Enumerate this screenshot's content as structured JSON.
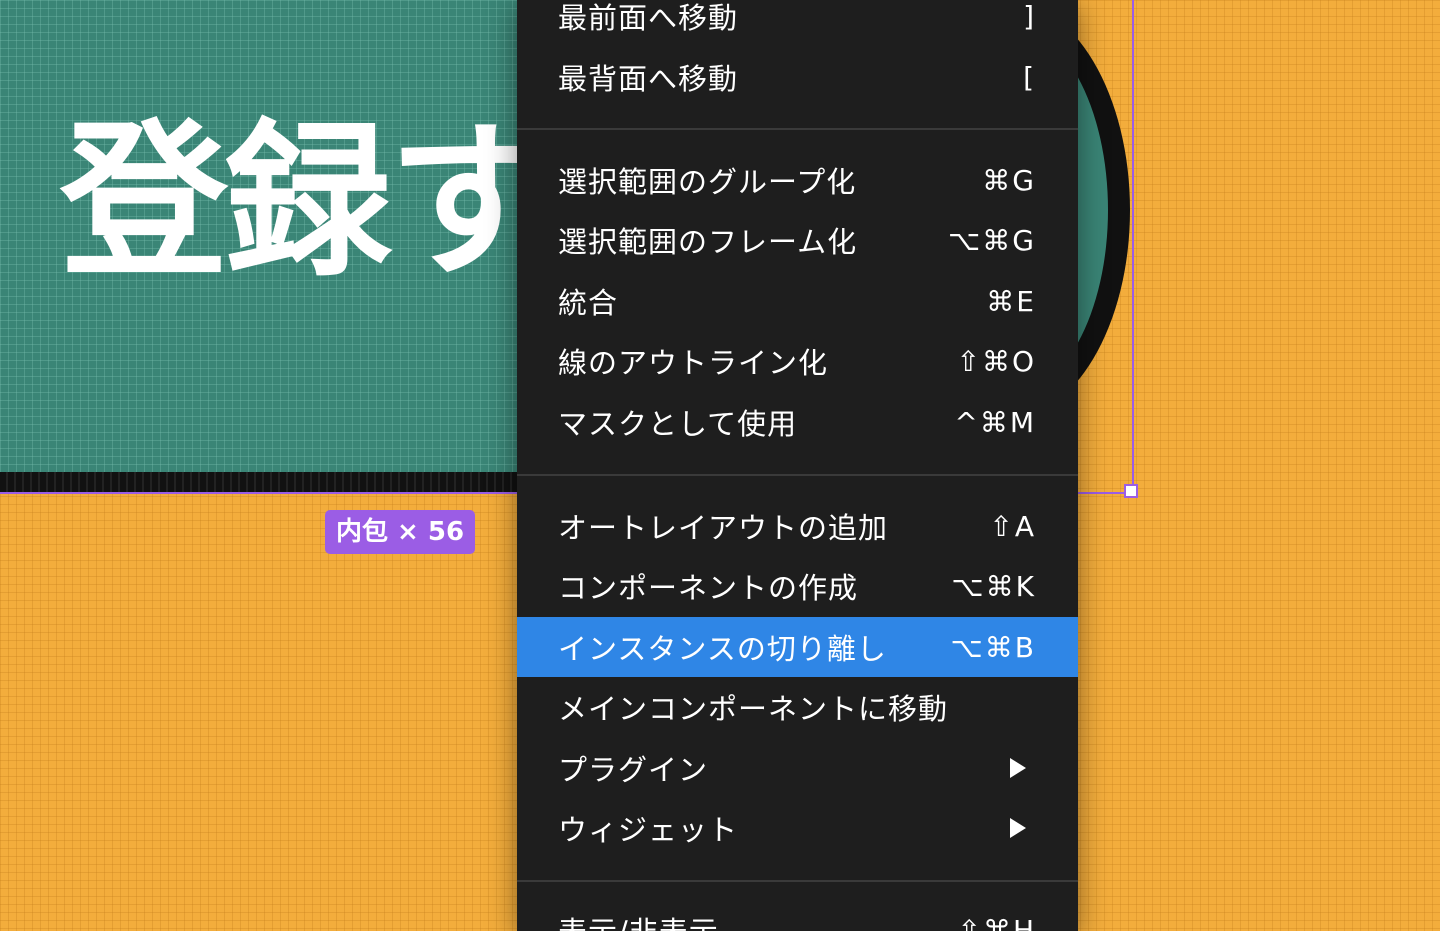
{
  "canvas": {
    "frame_text": "登録す",
    "hug_badge": "内包 × 56"
  },
  "colors": {
    "canvas_bg": "#f3ad3c",
    "frame_bg": "#3a8576",
    "selection": "#9b5de5",
    "menu_bg": "#1e1e1e",
    "menu_highlight": "#2f86e6"
  },
  "menu": {
    "items": [
      {
        "label": "最前面へ移動",
        "shortcut": "]"
      },
      {
        "label": "最背面へ移動",
        "shortcut": "["
      },
      {
        "label": "選択範囲のグループ化",
        "shortcut": "⌘G"
      },
      {
        "label": "選択範囲のフレーム化",
        "shortcut": "⌥⌘G"
      },
      {
        "label": "統合",
        "shortcut": "⌘E"
      },
      {
        "label": "線のアウトライン化",
        "shortcut": "⇧⌘O"
      },
      {
        "label": "マスクとして使用",
        "shortcut": "^⌘M"
      },
      {
        "label": "オートレイアウトの追加",
        "shortcut": "⇧A"
      },
      {
        "label": "コンポーネントの作成",
        "shortcut": "⌥⌘K"
      },
      {
        "label": "インスタンスの切り離し",
        "shortcut": "⌥⌘B",
        "highlighted": true
      },
      {
        "label": "メインコンポーネントに移動",
        "shortcut": ""
      },
      {
        "label": "プラグイン",
        "submenu_icon": "triangle-right-icon"
      },
      {
        "label": "ウィジェット",
        "submenu_icon": "triangle-right-icon"
      },
      {
        "label": "表示/非表示",
        "shortcut": "⇧⌘H"
      }
    ]
  }
}
